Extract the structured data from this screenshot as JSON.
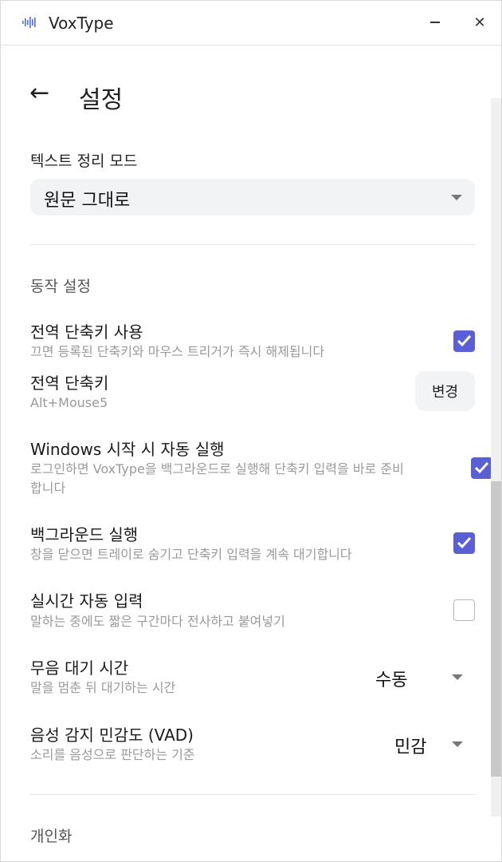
{
  "app": {
    "title": "VoxType",
    "icon": "waveform-icon"
  },
  "window_controls": {
    "minimize": "minimize-icon",
    "close_glyph": "✕"
  },
  "header": {
    "back_glyph": "←",
    "title": "설정"
  },
  "text_mode": {
    "label": "텍스트 정리 모드",
    "value": "원문 그대로"
  },
  "behavior": {
    "section_title": "동작 설정",
    "global_hotkey_enable": {
      "title": "전역 단축키 사용",
      "subtitle": "끄면 등록된 단축키와 마우스 트리거가 즉시 해제됩니다",
      "checked": true
    },
    "global_hotkey": {
      "title": "전역 단축키",
      "value": "Alt+Mouse5",
      "button_label": "변경"
    },
    "autostart": {
      "title": "Windows 시작 시 자동 실행",
      "subtitle_line1": "로그인하면 VoxType을 백그라운드로 실행해 단축키 입력을 바로 준비",
      "subtitle_line2": "합니다",
      "checked": true
    },
    "background_run": {
      "title": "백그라운드 실행",
      "subtitle": "창을 닫으면 트레이로 숨기고 단축키 입력을 계속 대기합니다",
      "checked": true
    },
    "realtime_input": {
      "title": "실시간 자동 입력",
      "subtitle": "말하는 중에도 짧은 구간마다 전사하고 붙여넣기",
      "checked": false
    },
    "silence_wait": {
      "title": "무음 대기 시간",
      "subtitle": "말을 멈춘 뒤 대기하는 시간",
      "value": "수동"
    },
    "vad": {
      "title": "음성 감지 민감도 (VAD)",
      "subtitle": "소리를 음성으로 판단하는 기준",
      "value": "민감"
    }
  },
  "personalization": {
    "section_title": "개인화"
  },
  "colors": {
    "accent": "#5b5fd6",
    "field_bg": "#f2f3f5",
    "muted_text": "#9a9a9a"
  }
}
